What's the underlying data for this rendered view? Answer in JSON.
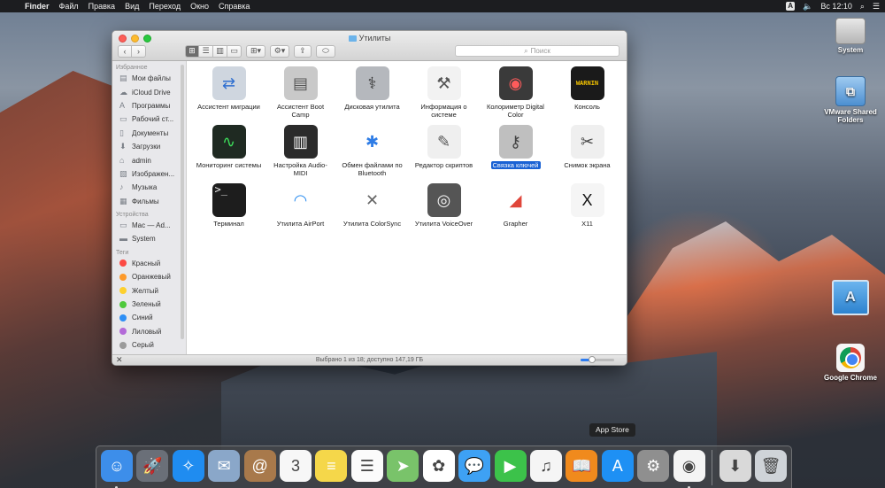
{
  "menubar": {
    "items": [
      "Finder",
      "Файл",
      "Правка",
      "Вид",
      "Переход",
      "Окно",
      "Справка"
    ],
    "input_source": "A",
    "clock": "Вс 12:10"
  },
  "desktop": {
    "icons": [
      {
        "label": "System"
      },
      {
        "label": "VMware Shared Folders"
      },
      {
        "label": ""
      },
      {
        "label": "Google Chrome"
      }
    ]
  },
  "finder": {
    "title": "Утилиты",
    "search_placeholder": "Поиск",
    "sidebar": {
      "favorites_header": "Избранное",
      "favorites": [
        "Мои файлы",
        "iCloud Drive",
        "Программы",
        "Рабочий ст...",
        "Документы",
        "Загрузки",
        "admin",
        "Изображен...",
        "Музыка",
        "Фильмы"
      ],
      "devices_header": "Устройства",
      "devices": [
        "Mac — Ad...",
        "System"
      ],
      "tags_header": "Теги",
      "tags": [
        {
          "label": "Красный",
          "color": "#fc4a44"
        },
        {
          "label": "Оранжевый",
          "color": "#fd9a2a"
        },
        {
          "label": "Желтый",
          "color": "#fdd02e"
        },
        {
          "label": "Зеленый",
          "color": "#4fc93c"
        },
        {
          "label": "Синий",
          "color": "#2e8ff5"
        },
        {
          "label": "Лиловый",
          "color": "#b36ad8"
        },
        {
          "label": "Серый",
          "color": "#9b9b9b"
        }
      ]
    },
    "apps": [
      {
        "label": "Ассистент миграции",
        "icon": "migration-assistant-icon",
        "glyph": "⇄",
        "bg": "#cfd6df",
        "fg": "#2f6fd0"
      },
      {
        "label": "Ассистент Boot Camp",
        "icon": "boot-camp-icon",
        "glyph": "▤",
        "bg": "#c9c9c9",
        "fg": "#555"
      },
      {
        "label": "Дисковая утилита",
        "icon": "disk-utility-icon",
        "glyph": "⚕",
        "bg": "#b5b8bd",
        "fg": "#333"
      },
      {
        "label": "Информация о системе",
        "icon": "system-information-icon",
        "glyph": "⚒",
        "bg": "#f2f2f2",
        "fg": "#555"
      },
      {
        "label": "Колориметр Digital Color",
        "icon": "digital-color-meter-icon",
        "glyph": "◉",
        "bg": "#3a3a3a",
        "fg": "#ff5b5b"
      },
      {
        "label": "Консоль",
        "icon": "console-icon",
        "glyph": "WARNIN",
        "bg": "#1a1a1a",
        "fg": "#f2c200"
      },
      {
        "label": "Мониторинг системы",
        "icon": "activity-monitor-icon",
        "glyph": "∿",
        "bg": "#1f2a22",
        "fg": "#3ddc5a"
      },
      {
        "label": "Настройка Audio-MIDI",
        "icon": "audio-midi-icon",
        "glyph": "▥",
        "bg": "#2b2b2b",
        "fg": "#fff"
      },
      {
        "label": "Обмен файлами по Bluetooth",
        "icon": "bluetooth-exchange-icon",
        "glyph": "✱",
        "bg": "#ffffff",
        "fg": "#2f7de6"
      },
      {
        "label": "Редактор скриптов",
        "icon": "script-editor-icon",
        "glyph": "✎",
        "bg": "#efefef",
        "fg": "#555"
      },
      {
        "label": "Связка ключей",
        "icon": "keychain-access-icon",
        "glyph": "⚷",
        "bg": "#bfbfbf",
        "fg": "#444"
      },
      {
        "label": "Снимок экрана",
        "icon": "grab-icon",
        "glyph": "✂",
        "bg": "#efefef",
        "fg": "#444"
      },
      {
        "label": "Терминал",
        "icon": "terminal-icon",
        "glyph": ">_",
        "bg": "#1d1d1d",
        "fg": "#e8e8e8"
      },
      {
        "label": "Утилита AirPort",
        "icon": "airport-utility-icon",
        "glyph": "◠",
        "bg": "#ffffff",
        "fg": "#2f8ff0"
      },
      {
        "label": "Утилита ColorSync",
        "icon": "colorsync-icon",
        "glyph": "✕",
        "bg": "#ffffff",
        "fg": "#666"
      },
      {
        "label": "Утилита VoiceOver",
        "icon": "voiceover-utility-icon",
        "glyph": "◎",
        "bg": "#555555",
        "fg": "#f5f5f5"
      },
      {
        "label": "Grapher",
        "icon": "grapher-icon",
        "glyph": "◢",
        "bg": "#ffffff",
        "fg": "#e0463a"
      },
      {
        "label": "X11",
        "icon": "x11-icon",
        "glyph": "X",
        "bg": "#f5f5f5",
        "fg": "#111"
      }
    ],
    "status": "Выбрано 1 из 18; доступно 147,19 ГБ",
    "icon_size_level": 0.35
  },
  "dock": {
    "tooltip": "App Store",
    "apps": [
      {
        "name": "finder",
        "icon": "finder-icon",
        "glyph": "☺",
        "bg": "#3d8eea",
        "running": true
      },
      {
        "name": "launchpad",
        "icon": "launchpad-icon",
        "glyph": "🚀",
        "bg": "#6a6f78",
        "running": false
      },
      {
        "name": "safari",
        "icon": "safari-icon",
        "glyph": "✧",
        "bg": "#1f8cf0",
        "running": false
      },
      {
        "name": "mail",
        "icon": "mail-icon",
        "glyph": "✉",
        "bg": "#8aa7c9",
        "running": false
      },
      {
        "name": "contacts",
        "icon": "contacts-icon",
        "glyph": "@",
        "bg": "#a8794b",
        "running": false
      },
      {
        "name": "calendar",
        "icon": "calendar-icon",
        "glyph": "3",
        "bg": "#f7f7f7",
        "running": false
      },
      {
        "name": "notes",
        "icon": "notes-icon",
        "glyph": "≡",
        "bg": "#f5d74a",
        "running": false
      },
      {
        "name": "reminders",
        "icon": "reminders-icon",
        "glyph": "☰",
        "bg": "#fbfbfb",
        "running": false
      },
      {
        "name": "maps",
        "icon": "maps-icon",
        "glyph": "➤",
        "bg": "#79c36a",
        "running": false
      },
      {
        "name": "photos",
        "icon": "photos-icon",
        "glyph": "✿",
        "bg": "#ffffff",
        "running": false
      },
      {
        "name": "messages",
        "icon": "messages-icon",
        "glyph": "💬",
        "bg": "#3ea1f4",
        "running": false
      },
      {
        "name": "facetime",
        "icon": "facetime-icon",
        "glyph": "▶",
        "bg": "#3cc24a",
        "running": false
      },
      {
        "name": "itunes",
        "icon": "itunes-icon",
        "glyph": "♫",
        "bg": "#f5f5f5",
        "running": false
      },
      {
        "name": "ibooks",
        "icon": "ibooks-icon",
        "glyph": "📖",
        "bg": "#f08a1d",
        "running": false
      },
      {
        "name": "app-store",
        "icon": "app-store-icon",
        "glyph": "A",
        "bg": "#1e90f4",
        "running": false
      },
      {
        "name": "system-preferences",
        "icon": "system-preferences-icon",
        "glyph": "⚙",
        "bg": "#8f8f8f",
        "running": false
      },
      {
        "name": "google-chrome",
        "icon": "chrome-icon",
        "glyph": "◉",
        "bg": "#f4f4f4",
        "running": true
      }
    ],
    "right": [
      {
        "name": "downloads",
        "icon": "downloads-stack-icon",
        "glyph": "⬇",
        "bg": "#d9d9d9"
      },
      {
        "name": "trash",
        "icon": "trash-icon",
        "glyph": "🗑",
        "bg": "#cfd3d8"
      }
    ]
  }
}
